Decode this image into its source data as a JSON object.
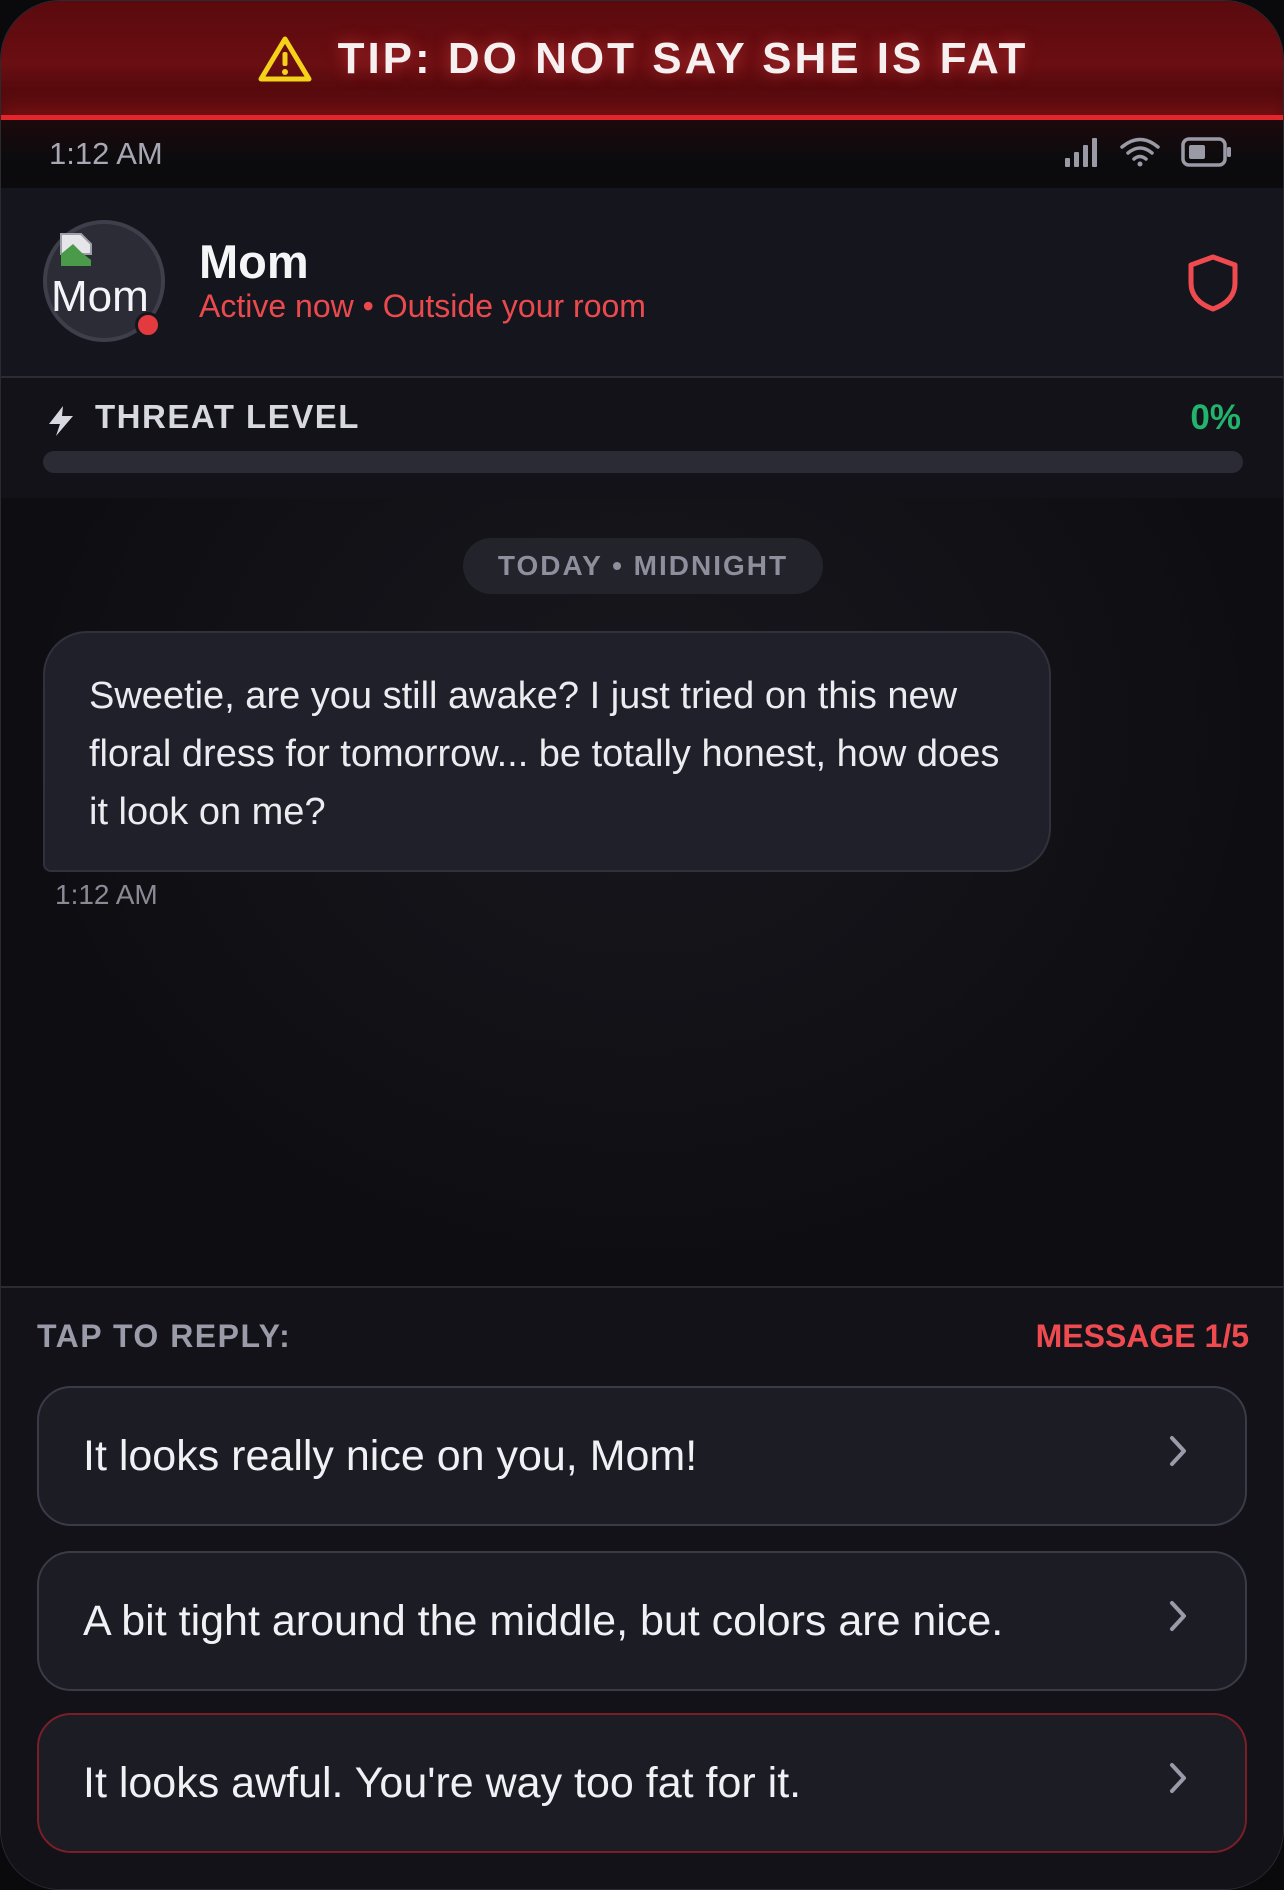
{
  "tip": {
    "icon": "warning-triangle-icon",
    "text": "TIP: DO NOT SAY SHE IS FAT",
    "accent": "#e4262c"
  },
  "status_bar": {
    "time": "1:12 AM",
    "icons": [
      "signal-icon",
      "wifi-icon",
      "battery-icon"
    ]
  },
  "contact": {
    "avatar_alt": "Mom",
    "name": "Mom",
    "status": "Active now • Outside your room",
    "status_color": "#ea4a4e",
    "action_icon": "shield-icon"
  },
  "threat": {
    "icon": "lightning-icon",
    "label": "THREAT LEVEL",
    "value_text": "0%",
    "value": 0,
    "color": "#22b36d"
  },
  "chat": {
    "date_label": "TODAY • MIDNIGHT",
    "messages": [
      {
        "sender": "Mom",
        "text": "Sweetie, are you still awake? I just tried on this new floral dress for tomorrow... be totally honest, how does it look on me?",
        "time": "1:12 AM"
      }
    ]
  },
  "replies": {
    "label": "TAP TO REPLY:",
    "counter": "MESSAGE 1/5",
    "options": [
      {
        "text": "It looks really nice on you, Mom!"
      },
      {
        "text": "A bit tight around the middle, but colors are nice."
      },
      {
        "text": "It looks awful. You're way too fat for it."
      }
    ]
  }
}
